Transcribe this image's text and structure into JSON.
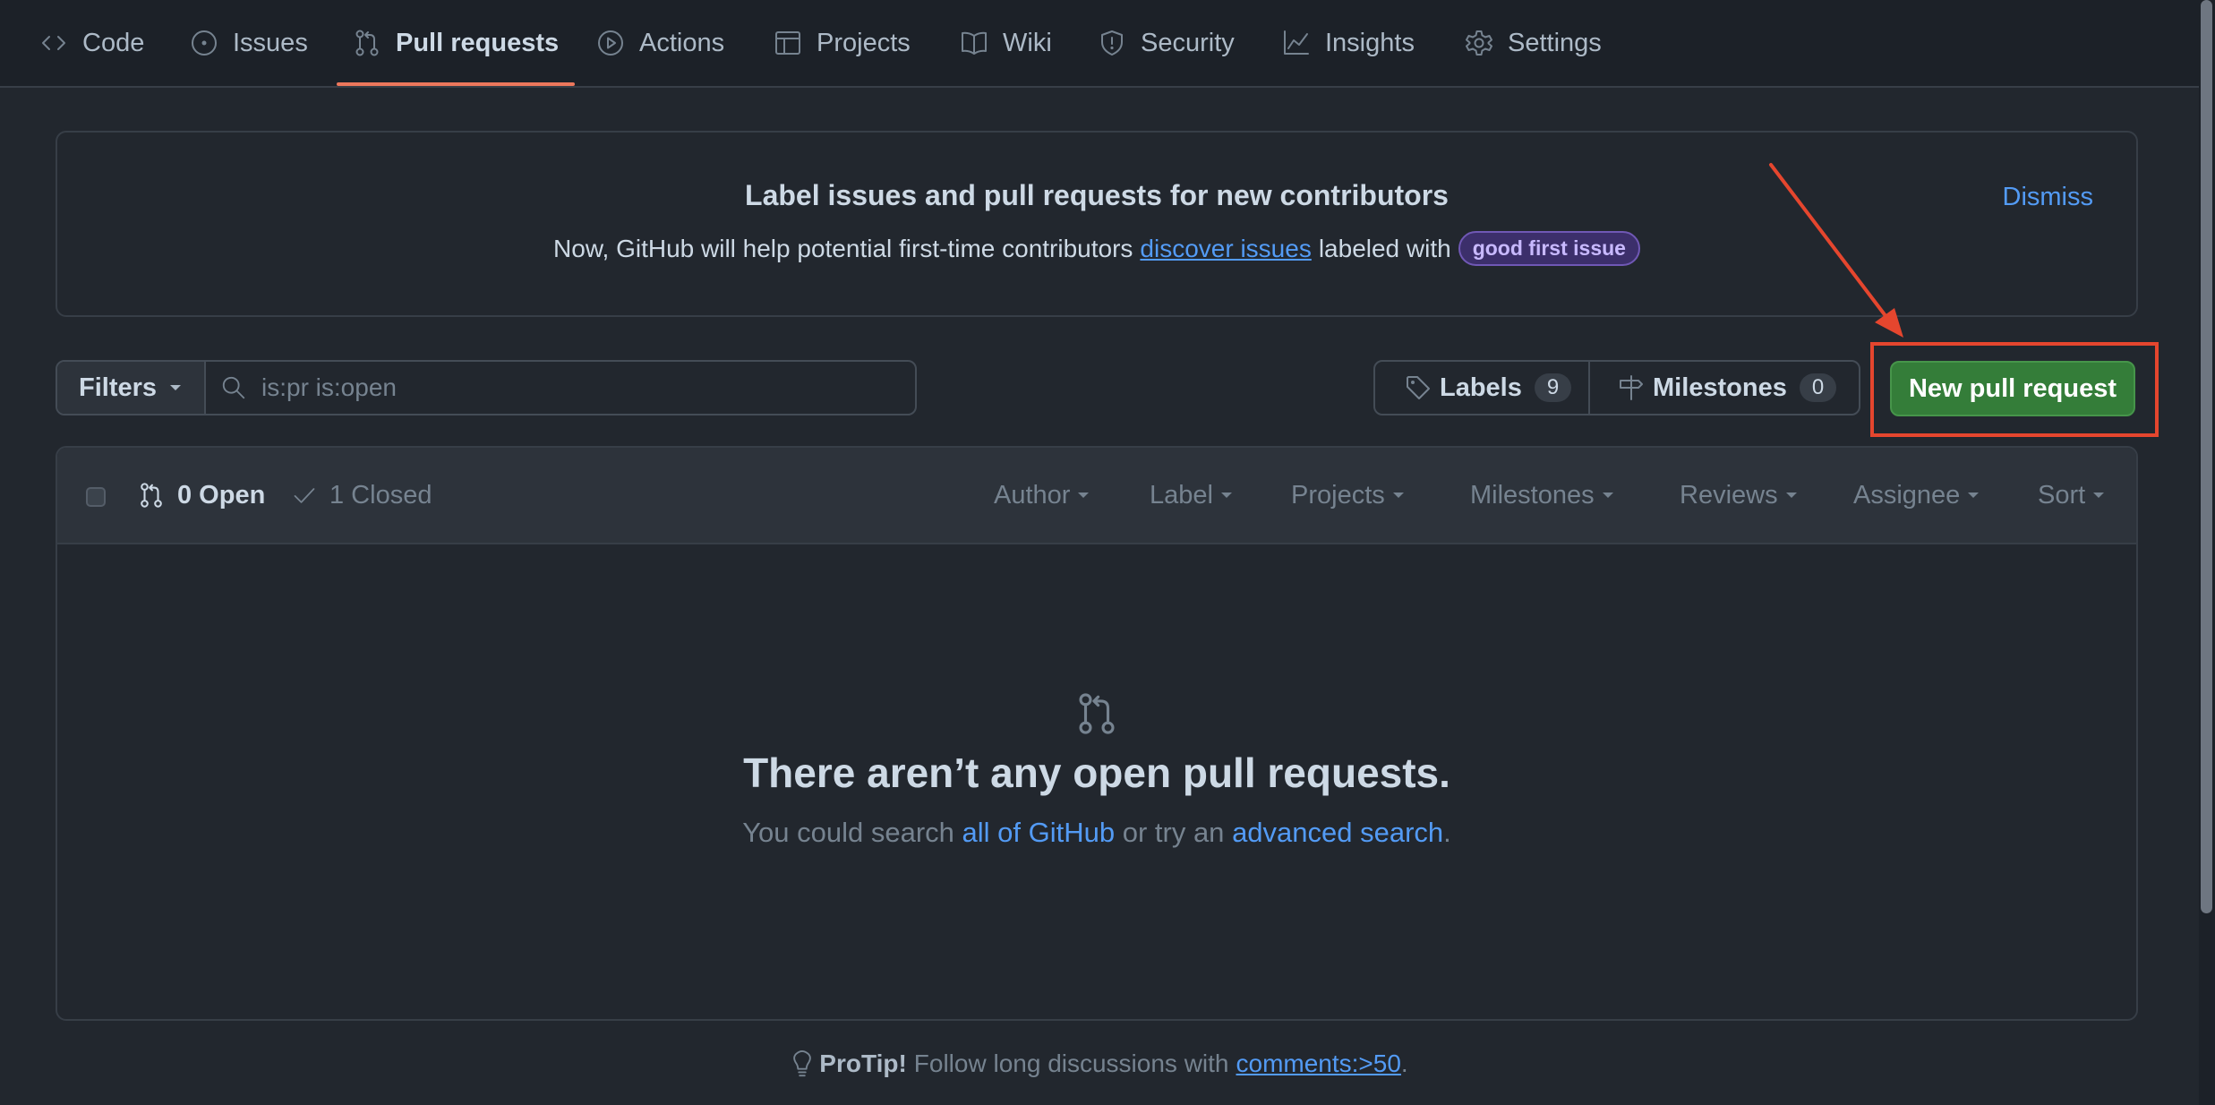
{
  "nav": {
    "tabs": [
      {
        "label": "Code",
        "icon": "code-icon"
      },
      {
        "label": "Issues",
        "icon": "issue-opened-icon"
      },
      {
        "label": "Pull requests",
        "icon": "git-pull-request-icon",
        "active": true
      },
      {
        "label": "Actions",
        "icon": "play-icon"
      },
      {
        "label": "Projects",
        "icon": "table-icon"
      },
      {
        "label": "Wiki",
        "icon": "book-icon"
      },
      {
        "label": "Security",
        "icon": "shield-icon"
      },
      {
        "label": "Insights",
        "icon": "graph-icon"
      },
      {
        "label": "Settings",
        "icon": "gear-icon"
      }
    ],
    "active_underline_color": "#ec775c"
  },
  "banner": {
    "title": "Label issues and pull requests for new contributors",
    "text_before": "Now, GitHub will help potential first-time contributors",
    "link": "discover issues",
    "text_after": "labeled with",
    "label_badge": "good first issue",
    "dismiss": "Dismiss"
  },
  "toolbar": {
    "filters_label": "Filters",
    "search_placeholder": "is:pr is:open",
    "labels_label": "Labels",
    "labels_count": "9",
    "milestones_label": "Milestones",
    "milestones_count": "0",
    "new_pr_label": "New pull request",
    "new_pr_color": "#347d39",
    "annotation_color": "#e5462e"
  },
  "list": {
    "open_label": "0 Open",
    "closed_label": "1 Closed",
    "filters": [
      "Author",
      "Label",
      "Projects",
      "Milestones",
      "Reviews",
      "Assignee",
      "Sort"
    ]
  },
  "empty": {
    "title": "There aren’t any open pull requests.",
    "text_before": "You could search",
    "link1": "all of GitHub",
    "text_middle": "or try an",
    "link2": "advanced search",
    "text_after": "."
  },
  "protip": {
    "label": "ProTip!",
    "text": "Follow long discussions with",
    "link": "comments:>50",
    "end": "."
  },
  "colors": {
    "background": "#22272e",
    "header_bg": "#1c2128",
    "link": "#539bf5"
  }
}
